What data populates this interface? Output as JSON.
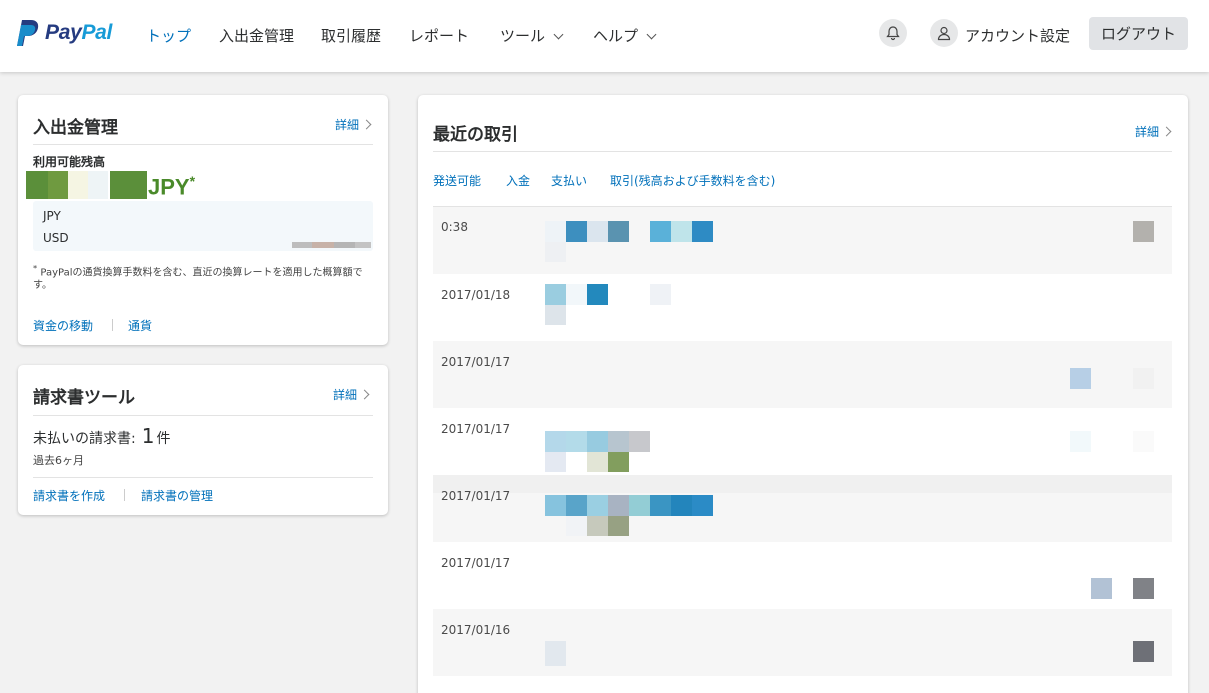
{
  "header": {
    "brand_pay": "Pay",
    "brand_pal": "Pal",
    "nav": {
      "top": "トップ",
      "funds": "入出金管理",
      "history": "取引履歴",
      "reports": "レポート",
      "tools": "ツール",
      "help": "ヘルプ"
    },
    "account": "アカウント設定",
    "logout": "ログアウト"
  },
  "funds_card": {
    "title": "入出金管理",
    "detail": "詳細",
    "balance_label": "利用可能残高",
    "balance_currency": "JPY",
    "asterisk": "*",
    "currencies": [
      "JPY",
      "USD"
    ],
    "footnote_mark": "*",
    "footnote": "PayPalの通貨換算手数料を含む、直近の換算レートを適用した概算額です。",
    "move_funds": "資金の移動",
    "currency": "通貨"
  },
  "invoice_card": {
    "title": "請求書ツール",
    "detail": "詳細",
    "unpaid_label": "未払いの請求書:",
    "unpaid_count": "1",
    "unpaid_unit": "件",
    "period": "過去6ヶ月",
    "create": "請求書を作成",
    "manage": "請求書の管理"
  },
  "tx_card": {
    "title": "最近の取引",
    "detail": "詳細",
    "tabs": [
      "発送可能",
      "入金",
      "支払い",
      "取引(残高および手数料を含む)"
    ],
    "rows": [
      {
        "date": "0:38"
      },
      {
        "date": "2017/01/18"
      },
      {
        "date": "2017/01/17"
      },
      {
        "date": "2017/01/17"
      },
      {
        "date": "2017/01/17"
      },
      {
        "date": "2017/01/17"
      },
      {
        "date": "2017/01/16"
      }
    ]
  },
  "colors": {
    "accent": "#0070ba",
    "brand_dark": "#253b80",
    "brand_light": "#179bd7",
    "balance_green": "#4a8a2a"
  }
}
